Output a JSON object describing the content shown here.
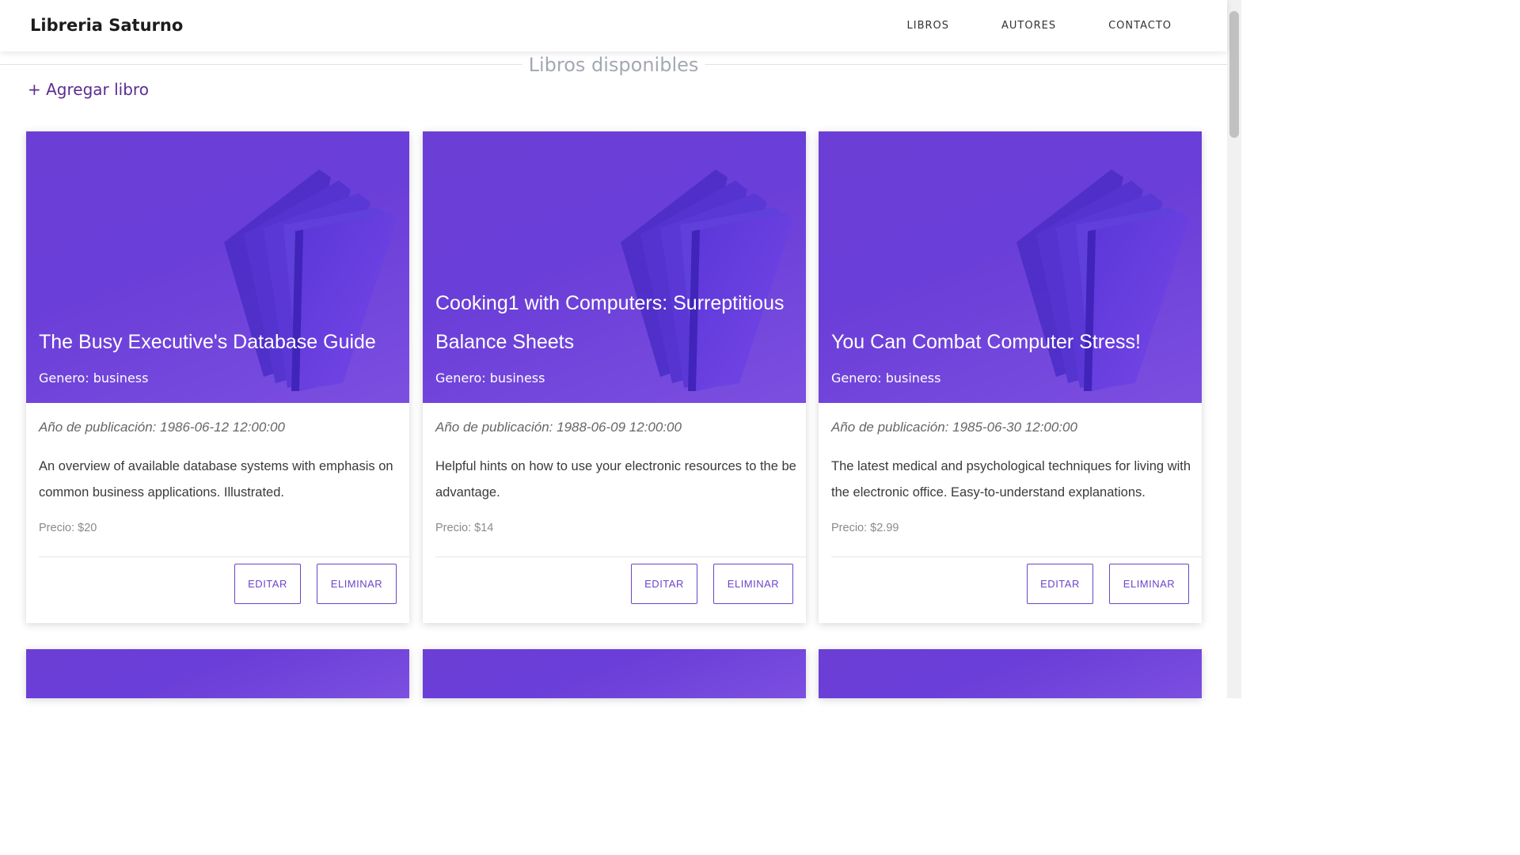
{
  "navbar": {
    "brand": "Libreria Saturno",
    "links": [
      "LIBROS",
      "AUTORES",
      "CONTACTO"
    ]
  },
  "section": {
    "title": "Libros disponibles",
    "add_button": "+ Agregar libro"
  },
  "books": [
    {
      "title": "The Busy Executive's Database Guide",
      "genre": "Genero: business",
      "published": "Año de publicación: 1986-06-12 12:00:00",
      "description": "An overview of available database systems with emphasis on common business applications. Illustrated.",
      "price": "Precio: $20"
    },
    {
      "title": "Cooking1 with Computers: Surreptitious Balance Sheets",
      "genre": "Genero: business",
      "published": "Año de publicación: 1988-06-09 12:00:00",
      "description": "Helpful hints on how to use your electronic resources to the be advantage.",
      "price": "Precio: $14"
    },
    {
      "title": "You Can Combat Computer Stress!",
      "genre": "Genero: business",
      "published": "Año de publicación: 1985-06-30 12:00:00",
      "description": "The latest medical and psychological techniques for living with the electronic office. Easy-to-understand explanations.",
      "price": "Precio: $2.99"
    }
  ],
  "actions": {
    "edit": "EDITAR",
    "delete": "ELIMINAR"
  },
  "colors": {
    "accent": "#6a45c8",
    "card_image": "#6b3fd6",
    "brand_link": "#5b2d91"
  }
}
